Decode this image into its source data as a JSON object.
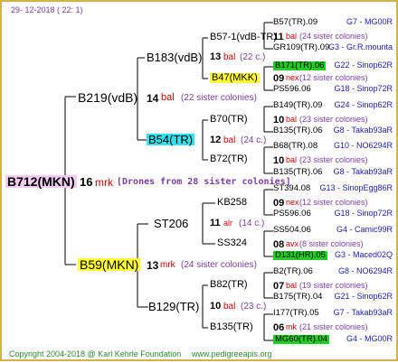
{
  "header": {
    "date": "29- 12-2018 ( 22: 1)"
  },
  "footer": {
    "copyright": "Copyright 2004-2018 @ Karl Kehrle Foundation",
    "website": "www.pedigreeapis.org"
  },
  "colors": {
    "frame": "#d4b24a",
    "red": "#cc0000",
    "blue": "#2020b0",
    "purple": "#7a3ca0",
    "highlight_yellow": "#ffff33",
    "highlight_cyan": "#33e0f0",
    "highlight_green": "#22cc22",
    "highlight_pink": "#f2ccf2"
  },
  "tree": {
    "root": {
      "label": "B712(MKN)",
      "count": "16",
      "mark": "mrk",
      "note": "[Drones from 28 sister colonies]"
    },
    "sire": {
      "label": "B219(vdB)",
      "count": "14",
      "mark": "bal",
      "note": "(22 sister colonies)"
    },
    "dam": {
      "label": "B59(MKN)",
      "count": "13",
      "mark": "mrk",
      "note": "(24 sister colonies)"
    },
    "sire_sire": {
      "label": "B183(vdB)",
      "count": "13",
      "mark": "bal",
      "note": "(22 c.)"
    },
    "sire_dam": {
      "label": "B54(TR)",
      "count": "12",
      "mark": "bal",
      "note": "(24 c.)"
    },
    "dam_sire": {
      "label": "ST206",
      "count": "11",
      "mark": "alr",
      "note": "(14 c.)"
    },
    "dam_dam": {
      "label": "B129(TR)",
      "count": "10",
      "mark": "bal",
      "note": "(23 c.)"
    },
    "g3": [
      {
        "label": "B57-1(vdB-TR)",
        "count": "11",
        "mark": "bal",
        "note": "(24 sister colonies)"
      },
      {
        "label": "B47(MKK)",
        "count": "09",
        "mark": "nex",
        "note": "(12 sister colonies)"
      },
      {
        "label": "B70(TR)",
        "count": "10",
        "mark": "bal",
        "note": "(23 sister colonies)"
      },
      {
        "label": "B72(TR)",
        "count": "10",
        "mark": "bal",
        "note": "(23 sister colonies)"
      },
      {
        "label": "KB258",
        "count": "09",
        "mark": "nex",
        "note": "(12 sister colonies)"
      },
      {
        "label": "SS324",
        "count": "08",
        "mark": "avx",
        "note": "(8 sister colonies)"
      },
      {
        "label": "B82(TR)",
        "count": "07",
        "mark": "bal",
        "note": "(19 sister colonies)"
      },
      {
        "label": "B135(TR)",
        "count": "06",
        "mark": "mk",
        "note": "(21 sister colonies)"
      }
    ],
    "g4": [
      {
        "label": "B57(TR).09",
        "code": "G7 - MG00R"
      },
      {
        "label": "GR109(TR).09",
        "code": "G3 - Gr.R.mounta"
      },
      {
        "label": "B171(TR).06",
        "code": "G22 - Sinop62R"
      },
      {
        "label": "PS596.06",
        "code": "G18 - Sinop72R"
      },
      {
        "label": "B149(TR).09",
        "code": "G24 - Sinop62R"
      },
      {
        "label": "B135(TR).06",
        "code": "G8 - Takab93aR"
      },
      {
        "label": "B68(TR).08",
        "code": "G10 - NO6294R"
      },
      {
        "label": "B135(TR).06",
        "code": "G8 - Takab93aR"
      },
      {
        "label": "ST394.08",
        "code": "G13 - SinopEgg86R"
      },
      {
        "label": "PS596.06",
        "code": "G18 - Sinop72R"
      },
      {
        "label": "SS504.06",
        "code": "G4 - Camic99R"
      },
      {
        "label": "D131(HR).05",
        "code": "G3 - Maced02Q"
      },
      {
        "label": "B2(TR).06",
        "code": "G8 - NO6294R"
      },
      {
        "label": "B175(TR).04",
        "code": "G21 - Sinop62R"
      },
      {
        "label": "I177(TR).05",
        "code": "G7 - Takab93aR"
      },
      {
        "label": "MG60(TR).04",
        "code": "G4 - MG00R"
      }
    ]
  }
}
